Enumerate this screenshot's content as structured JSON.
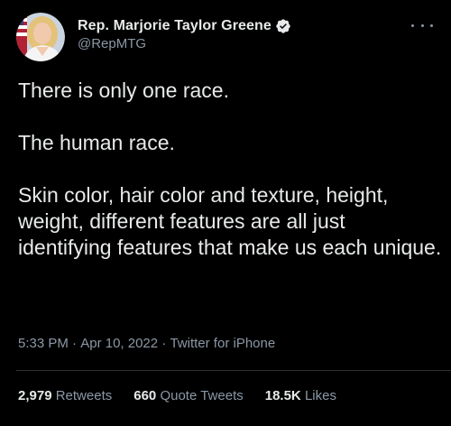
{
  "author": {
    "display_name": "Rep. Marjorie Taylor Greene",
    "handle": "@RepMTG"
  },
  "tweet": {
    "paragraphs": [
      "There is only one race.",
      "The human race.",
      "Skin color, hair color and texture, height, weight, different features are all just identifying features that make us each unique."
    ],
    "time": "5:33 PM",
    "date": "Apr 10, 2022",
    "source": "Twitter for iPhone",
    "separator": "·"
  },
  "stats": {
    "retweets_count": "2,979",
    "retweets_label": "Retweets",
    "quotes_count": "660",
    "quotes_label": "Quote Tweets",
    "likes_count": "18.5K",
    "likes_label": "Likes"
  },
  "icons": {
    "verified": "verified-badge-icon",
    "more": "more-options-icon"
  },
  "colors": {
    "background": "#000000",
    "text_primary": "#e7e9ea",
    "text_secondary": "#8b98a5",
    "divider": "#2f3336"
  }
}
